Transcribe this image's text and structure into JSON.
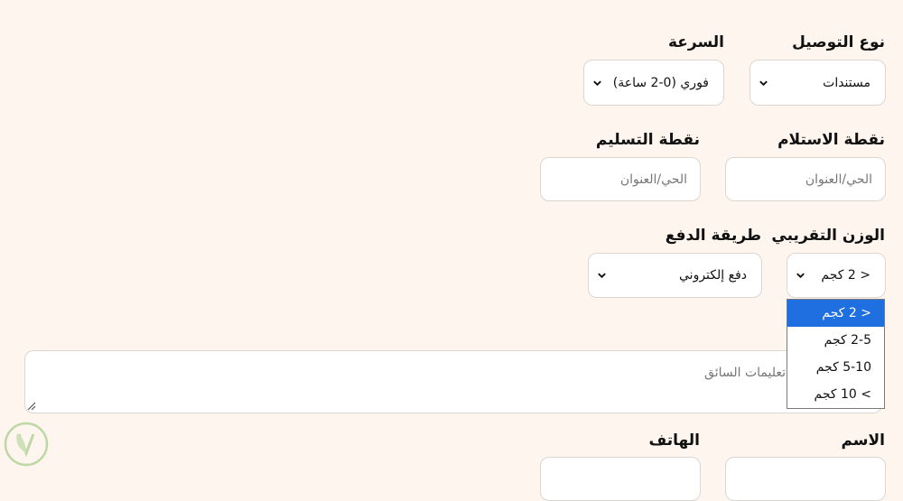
{
  "delivery_type": {
    "label": "نوع التوصيل",
    "value": "مستندات",
    "icon": "chevron-down-icon"
  },
  "speed": {
    "label": "السرعة",
    "value": "فوري (0-2 ساعة)",
    "icon": "chevron-down-icon"
  },
  "pickup": {
    "label": "نقطة الاستلام",
    "placeholder": "الحي/العنوان"
  },
  "dropoff": {
    "label": "نقطة التسليم",
    "placeholder": "الحي/العنوان"
  },
  "weight": {
    "label": "الوزن التقريبي",
    "value": "< 2 كجم",
    "options": [
      "< 2 كجم",
      "2-5 كجم",
      "5-10 كجم",
      "> 10 كجم"
    ],
    "selected_index": 0
  },
  "payment": {
    "label": "طريقة الدفع",
    "value": "دفع إلكتروني"
  },
  "driver_notes": {
    "placeholder": "تعليمات السائق"
  },
  "name": {
    "label": "الاسم"
  },
  "phone": {
    "label": "الهاتف"
  },
  "colors": {
    "page_bg": "#fdf5ee",
    "selected_option": "#1f6fe0",
    "logo": "#8bbf6a"
  }
}
